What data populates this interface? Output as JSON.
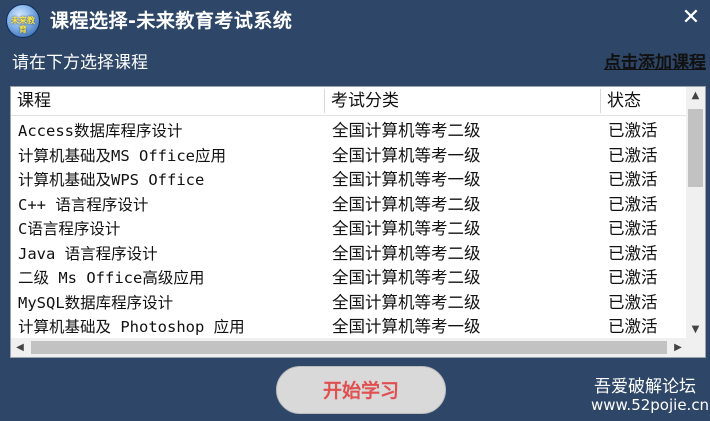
{
  "window": {
    "title": "课程选择-未来教育考试系统",
    "logo_text": "未来教育",
    "close_glyph": "✕"
  },
  "prompt": "请在下方选择课程",
  "add_link": "点击添加课程",
  "table": {
    "columns": [
      "课程",
      "考试分类",
      "状态"
    ],
    "rows": [
      [
        "Access数据库程序设计",
        "全国计算机等考二级",
        "已激活"
      ],
      [
        "计算机基础及MS Office应用",
        "全国计算机等考一级",
        "已激活"
      ],
      [
        "计算机基础及WPS Office",
        "全国计算机等考一级",
        "已激活"
      ],
      [
        "C++ 语言程序设计",
        "全国计算机等考二级",
        "已激活"
      ],
      [
        "C语言程序设计",
        "全国计算机等考二级",
        "已激活"
      ],
      [
        "Java 语言程序设计",
        "全国计算机等考二级",
        "已激活"
      ],
      [
        "二级 Ms Office高级应用",
        "全国计算机等考二级",
        "已激活"
      ],
      [
        "MySQL数据库程序设计",
        "全国计算机等考二级",
        "已激活"
      ],
      [
        "计算机基础及 Photoshop 应用",
        "全国计算机等考一级",
        "已激活"
      ]
    ]
  },
  "start_button": "开始学习",
  "watermark": {
    "line1": "吾爱破解论坛",
    "line2": "www.52pojie.cn"
  },
  "icons": {
    "scroll_up": "▲",
    "scroll_down": "▼",
    "scroll_left": "◀",
    "scroll_right": "▶"
  },
  "colors": {
    "window_bg": "#2e4667",
    "start_text": "#e05050"
  }
}
